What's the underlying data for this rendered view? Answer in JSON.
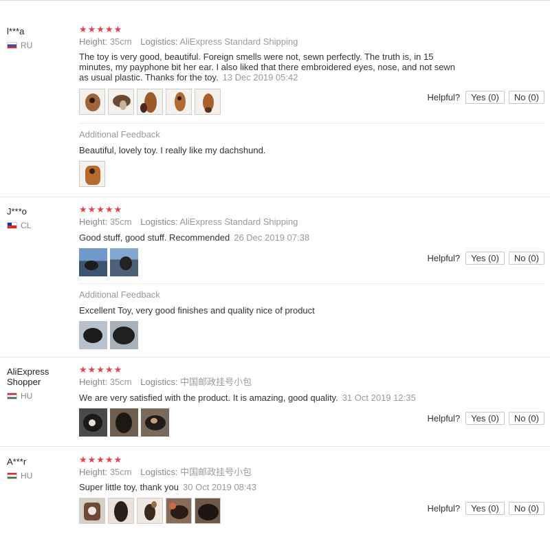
{
  "reviews": [
    {
      "user": "l***a",
      "country": "RU",
      "stars": "★★★★★",
      "height_label": "Height:",
      "height_value": "35cm",
      "logistics_label": "Logistics:",
      "logistics_value": "AliExpress Standard Shipping",
      "text_lines": [
        "The toy is very good, beautiful. Foreign smells were not, sewn perfectly. The truth is, in 15",
        "minutes, my payphone bit her ear. I also liked that there embroidered eyes, nose, and not sewn",
        "as usual plastic. Thanks for the toy."
      ],
      "date": "13 Dec 2019 05:42",
      "helpful": "Helpful?",
      "yes": "Yes (0)",
      "no": "No (0)",
      "additional_title": "Additional Feedback",
      "additional_text": "Beautiful, lovely toy. I really like my dachshund."
    },
    {
      "user": "J***o",
      "country": "CL",
      "stars": "★★★★★",
      "height_label": "Height:",
      "height_value": "35cm",
      "logistics_label": "Logistics:",
      "logistics_value": "AliExpress Standard Shipping",
      "text": "Good stuff, good stuff. Recommended",
      "date": "26 Dec 2019 07:38",
      "helpful": "Helpful?",
      "yes": "Yes (0)",
      "no": "No (0)",
      "additional_title": "Additional Feedback",
      "additional_text": "Excellent Toy, very good finishes and quality nice of product"
    },
    {
      "user_line1": "AliExpress",
      "user_line2": "Shopper",
      "country": "HU",
      "stars": "★★★★★",
      "height_label": "Height:",
      "height_value": "35cm",
      "logistics_label": "Logistics:",
      "logistics_value": "中国邮政挂号小包",
      "text": "We are very satisfied with the product. It is amazing, good quality.",
      "date": "31 Oct 2019 12:35",
      "helpful": "Helpful?",
      "yes": "Yes (0)",
      "no": "No (0)"
    },
    {
      "user": "A***r",
      "country": "HU",
      "stars": "★★★★★",
      "height_label": "Height:",
      "height_value": "35cm",
      "logistics_label": "Logistics:",
      "logistics_value": "中国邮政挂号小包",
      "text": "Super little toy, thank you",
      "date": "30 Oct 2019 08:43",
      "helpful": "Helpful?",
      "yes": "Yes (0)",
      "no": "No (0)"
    }
  ],
  "colors": {
    "star": "#e8414a",
    "muted_text": "#999999",
    "body_text": "#333333",
    "separator": "#e6e6e6"
  },
  "icons": {
    "flag_ru": "flag-russia-icon",
    "flag_cl": "flag-chile-icon",
    "flag_hu": "flag-hungary-icon"
  }
}
